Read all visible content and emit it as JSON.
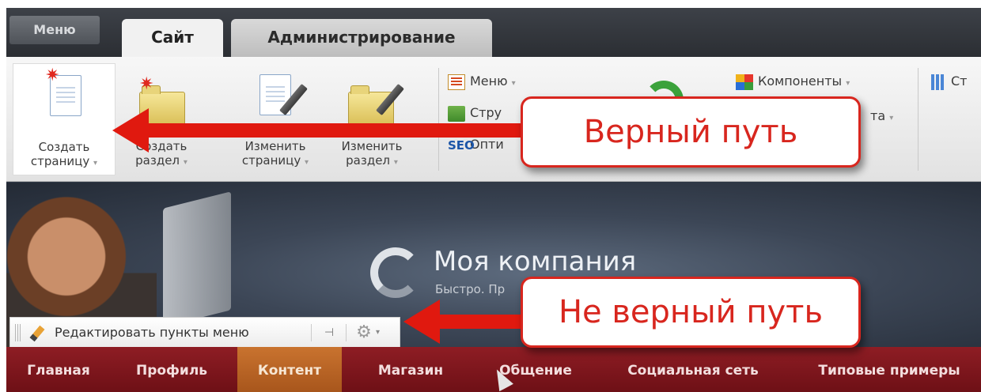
{
  "tabbar": {
    "menu_button": "Меню",
    "tabs": [
      {
        "label": "Сайт",
        "active": true
      },
      {
        "label": "Администрирование",
        "active": false
      }
    ]
  },
  "ribbon": {
    "create_page": {
      "line1": "Создать",
      "line2": "страницу"
    },
    "create_section": {
      "line1": "Создать",
      "line2": "раздел"
    },
    "edit_page": {
      "line1": "Изменить",
      "line2": "страницу"
    },
    "edit_section": {
      "line1": "Изменить",
      "line2": "раздел"
    },
    "menu_item": "Меню",
    "structure_item": "Стру",
    "seo_item": "Опти",
    "components_item": "Компоненты",
    "template_item": "та",
    "stats_item": "Ст",
    "caret": "▾"
  },
  "banner": {
    "company_name": "Моя компания",
    "slogan": "Быстро. Пр"
  },
  "edit_toolbar": {
    "label": "Редактировать пункты меню"
  },
  "nav": {
    "items": [
      {
        "label": "Главная",
        "active": false
      },
      {
        "label": "Профиль",
        "active": false
      },
      {
        "label": "Контент",
        "active": true
      },
      {
        "label": "Магазин",
        "active": false
      },
      {
        "label": "Общение",
        "active": false
      },
      {
        "label": "Социальная сеть",
        "active": false
      },
      {
        "label": "Типовые примеры",
        "active": false
      }
    ]
  },
  "annotations": {
    "correct": "Верный путь",
    "wrong": "Не верный путь"
  },
  "colors": {
    "annotation_red": "#d8261e",
    "nav_bg": "#7e151c",
    "nav_active": "#b8642a"
  }
}
